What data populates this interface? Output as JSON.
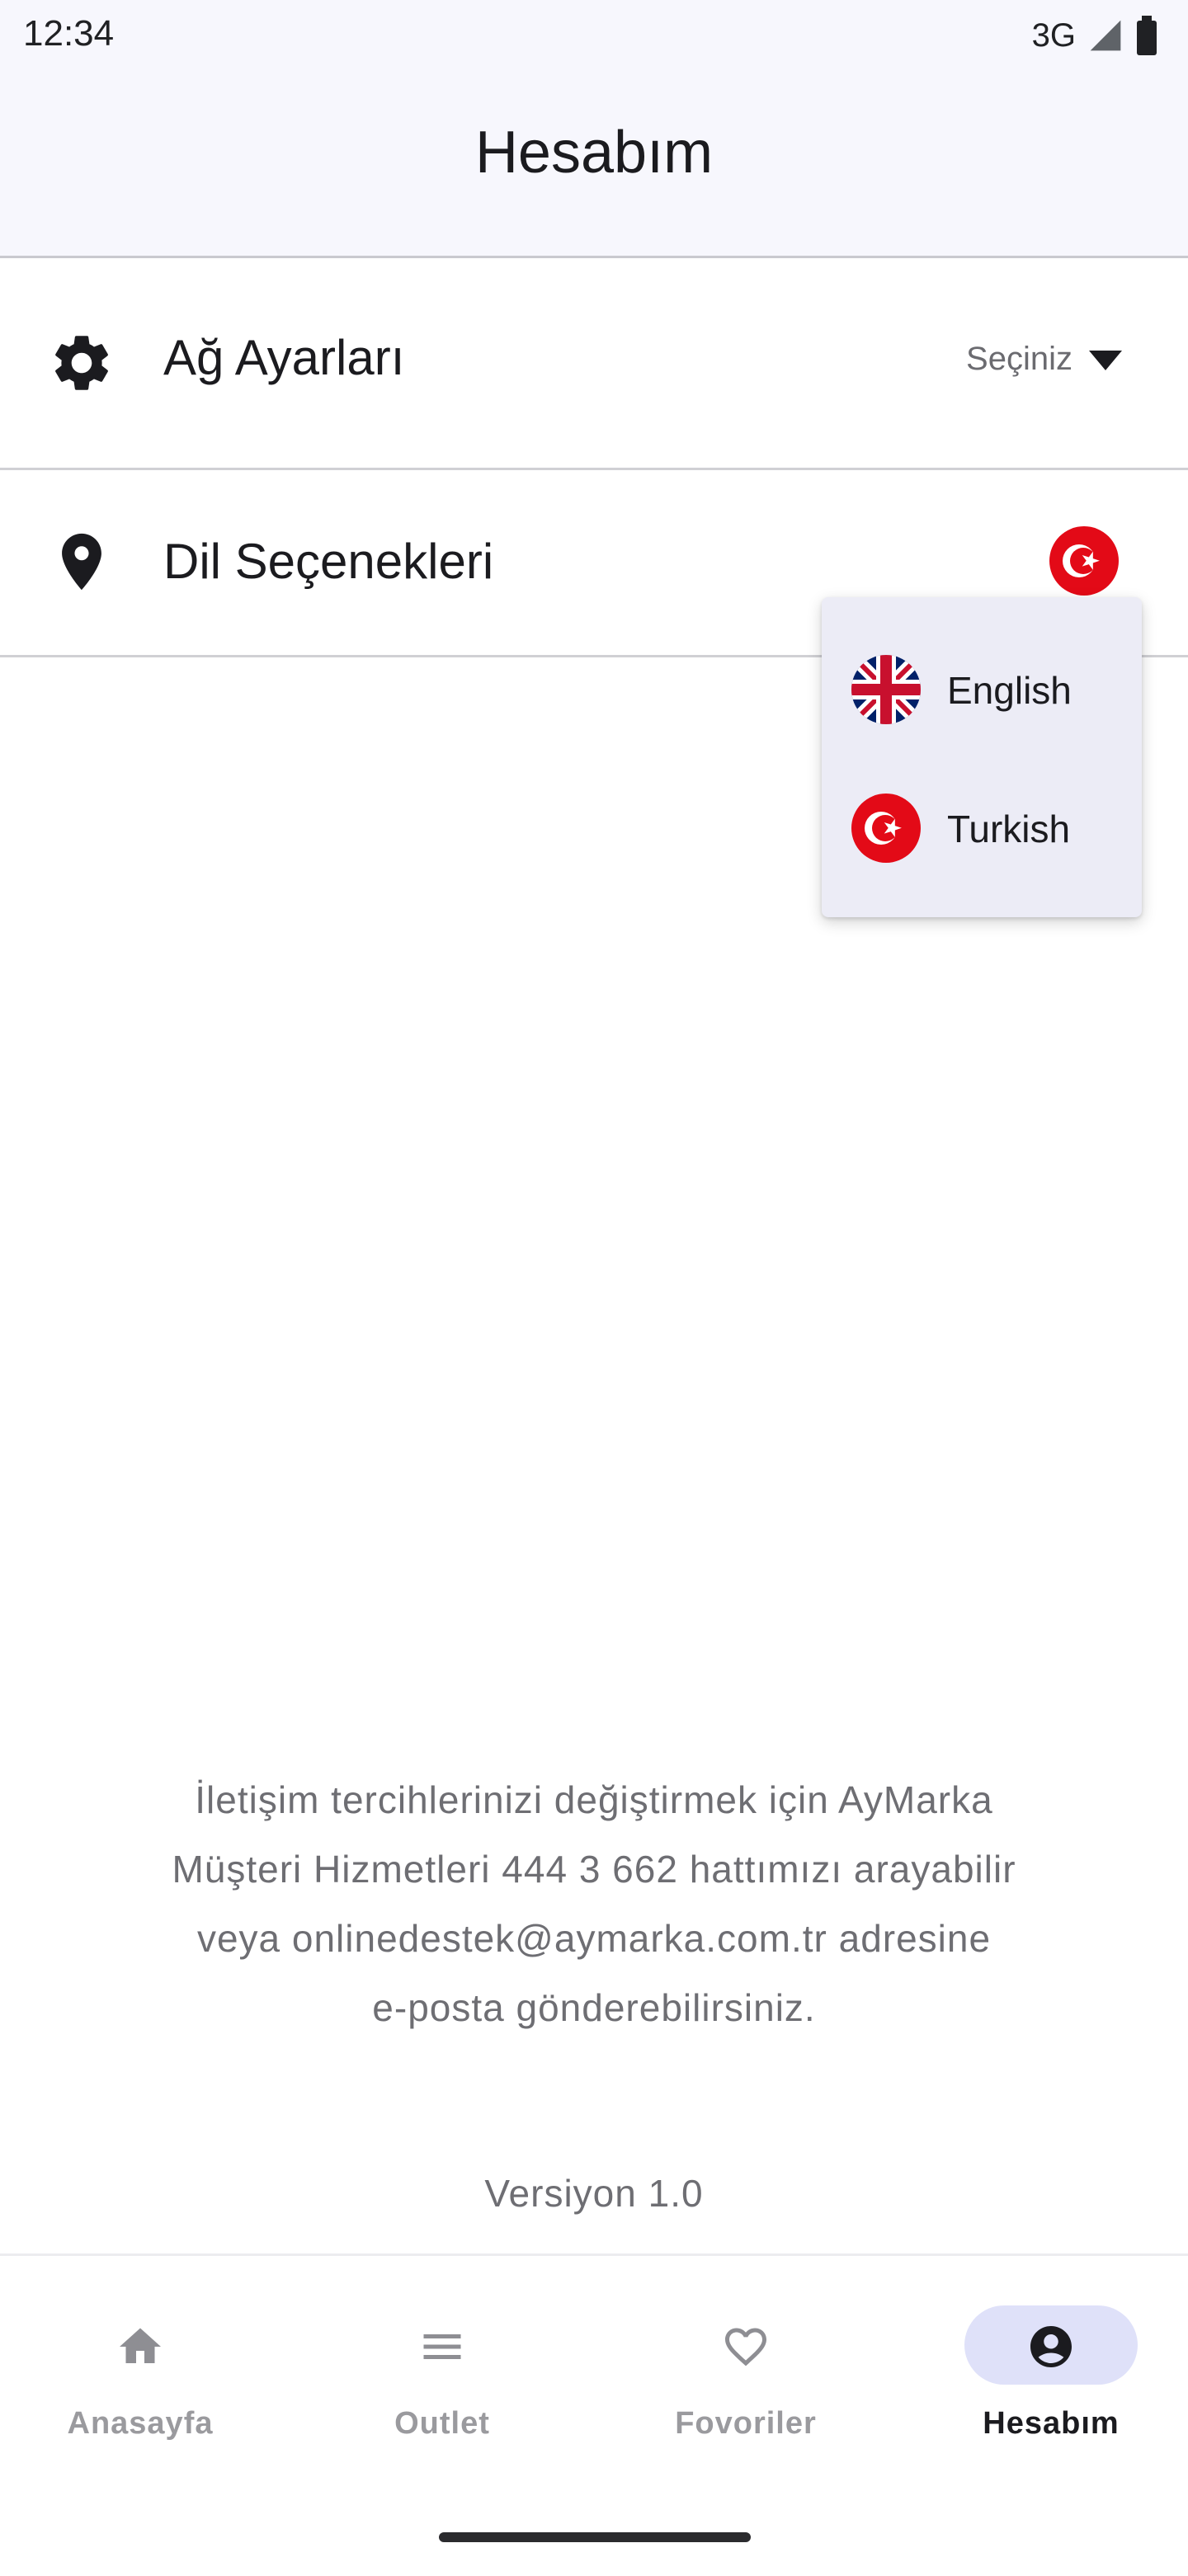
{
  "status_bar": {
    "time": "12:34",
    "network": "3G",
    "icons": [
      "signal-icon",
      "battery-icon"
    ]
  },
  "app_bar": {
    "title": "Hesabım"
  },
  "settings": {
    "network": {
      "icon": "gear-icon",
      "label": "Ağ Ayarları",
      "select_value": "Seçiniz"
    },
    "language": {
      "icon": "location-pin-icon",
      "label": "Dil Seçenekleri",
      "selected_flag": "turkey-flag-icon"
    }
  },
  "language_menu": {
    "items": [
      {
        "label": "English",
        "icon": "uk-flag-icon"
      },
      {
        "label": "Turkish",
        "icon": "turkey-flag-icon"
      }
    ]
  },
  "info": {
    "lines": [
      "İletişim tercihlerinizi değiştirmek için AyMarka",
      "Müşteri Hizmetleri 444 3 662 hattımızı arayabilir",
      "veya onlinedestek@aymarka.com.tr adresine",
      "e-posta gönderebilirsiniz."
    ]
  },
  "version": "Versiyon 1.0",
  "bottom_nav": {
    "items": [
      {
        "label": "Anasayfa",
        "icon": "home-icon",
        "active": false
      },
      {
        "label": "Outlet",
        "icon": "menu-icon",
        "active": false
      },
      {
        "label": "Fovoriler",
        "icon": "heart-icon",
        "active": false
      },
      {
        "label": "Hesabım",
        "icon": "account-icon",
        "active": true
      }
    ]
  },
  "colors": {
    "accent_pill": "#dfe1f9",
    "flag_red": "#e30a17",
    "menu_bg": "#ececf6",
    "header_bg": "#f7f7fd"
  }
}
